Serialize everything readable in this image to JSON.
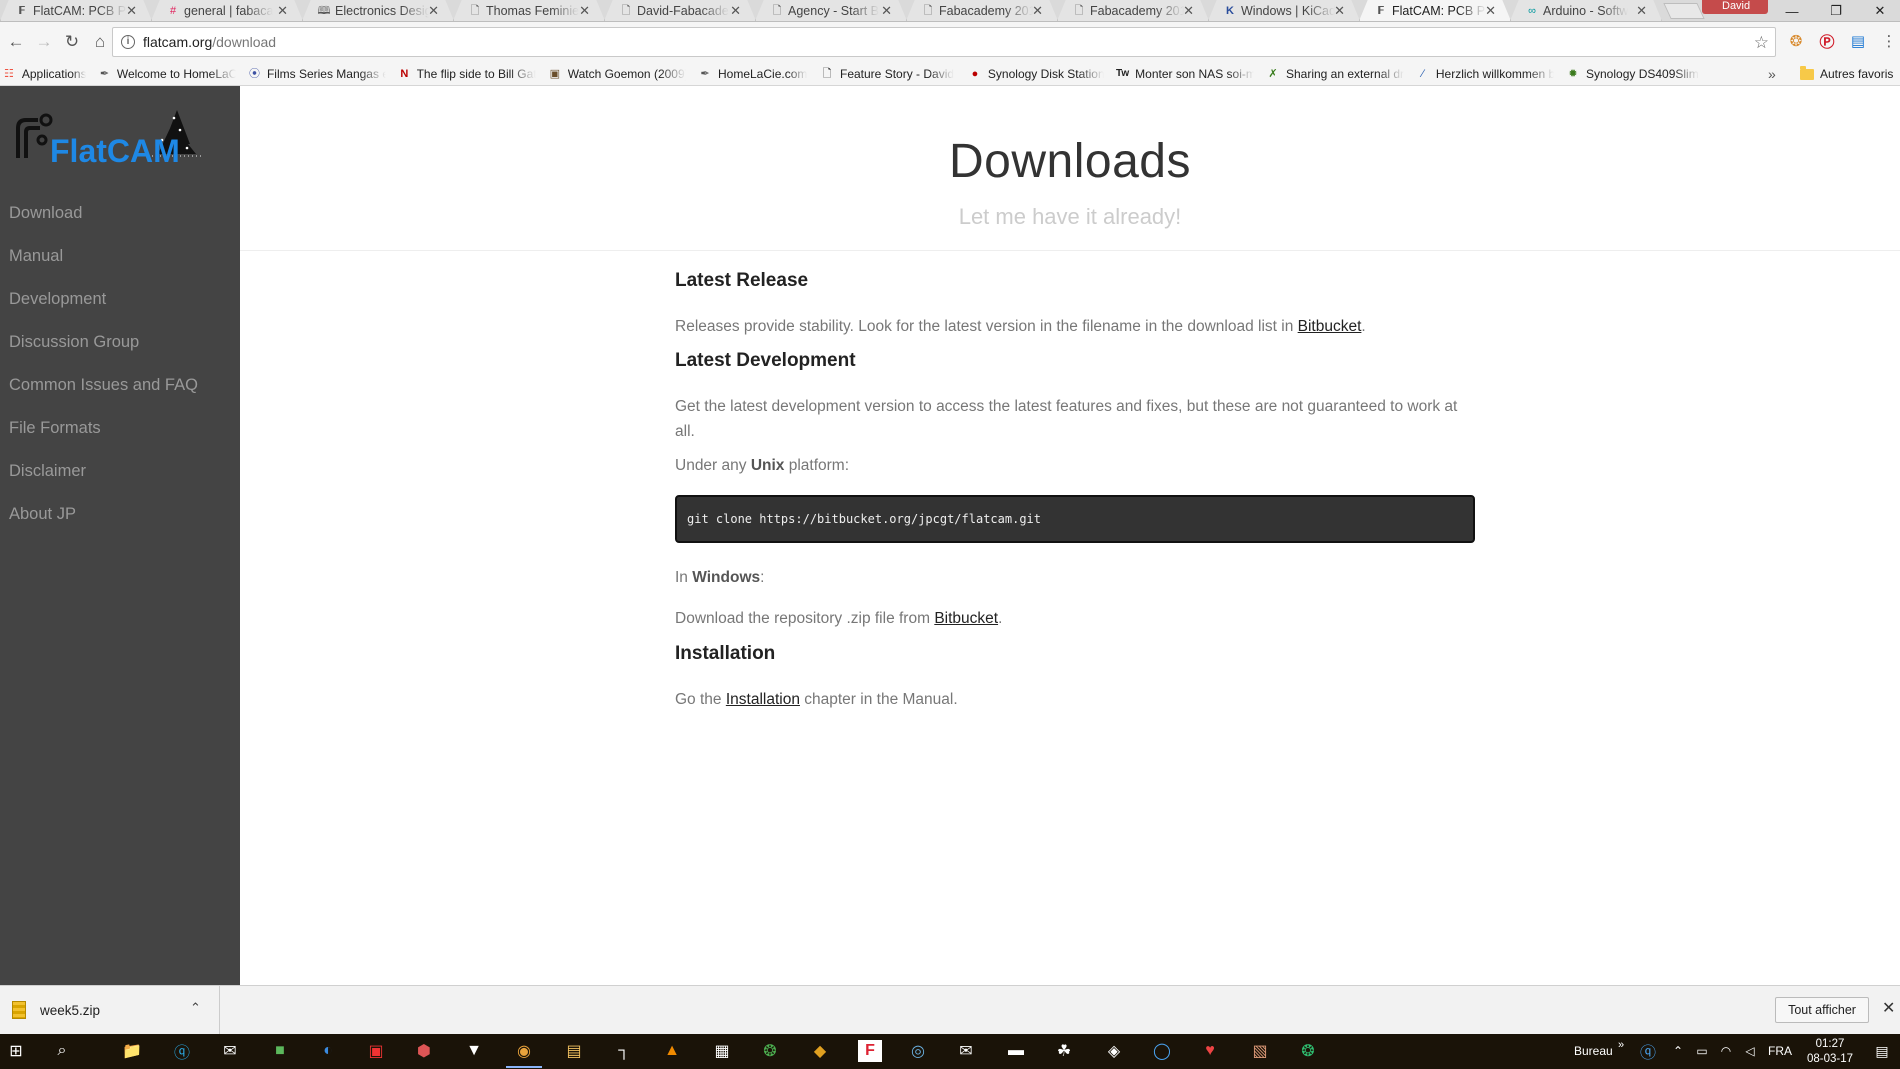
{
  "browser": {
    "tabs": [
      {
        "label": "FlatCAM: PCB Pr",
        "icon": "flatcam-icon",
        "active": false
      },
      {
        "label": "general | fabaca",
        "icon": "slack-icon",
        "active": false
      },
      {
        "label": "Electronics Desig",
        "icon": "book-icon",
        "active": false
      },
      {
        "label": "Thomas Feminie",
        "icon": "page-icon",
        "active": false
      },
      {
        "label": "David-Fabacade",
        "icon": "page-icon",
        "active": false
      },
      {
        "label": "Agency - Start B",
        "icon": "page-icon",
        "active": false
      },
      {
        "label": "Fabacademy 201",
        "icon": "page-icon",
        "active": false
      },
      {
        "label": "Fabacademy 201",
        "icon": "page-icon",
        "active": false
      },
      {
        "label": "Windows | KiCad",
        "icon": "kicad-icon",
        "active": false
      },
      {
        "label": "FlatCAM: PCB Pr",
        "icon": "flatcam-icon",
        "active": true
      },
      {
        "label": "Arduino - Softw",
        "icon": "arduino-icon",
        "active": false
      }
    ],
    "profile_name": "David",
    "url_host": "flatcam.org",
    "url_path": "/download",
    "bookmarks": [
      {
        "label": "Applications",
        "icon": "apps-grid-icon"
      },
      {
        "label": "Welcome to HomeLaCie",
        "icon": "feather-icon"
      },
      {
        "label": "Films Series Mangas en",
        "icon": "link-icon"
      },
      {
        "label": "The flip side to Bill Gates",
        "icon": "netflix-icon"
      },
      {
        "label": "Watch Goemon (2009)",
        "icon": "film-icon"
      },
      {
        "label": "HomeLaCie.com",
        "icon": "feather-icon"
      },
      {
        "label": "Feature Story - David",
        "icon": "page-icon"
      },
      {
        "label": "Synology Disk Station",
        "icon": "synology-icon"
      },
      {
        "label": "Monter son NAS soi-même",
        "icon": "tw-icon"
      },
      {
        "label": "Sharing an external dr",
        "icon": "x-icon"
      },
      {
        "label": "Herzlich willkommen b",
        "icon": "slash-icon"
      },
      {
        "label": "Synology DS409Slim",
        "icon": "star-badge-icon"
      }
    ],
    "other_bookmarks": "Autres favoris"
  },
  "sidebar": {
    "logo_text": "FlatCAM",
    "items": [
      {
        "label": "Download"
      },
      {
        "label": "Manual"
      },
      {
        "label": "Development"
      },
      {
        "label": "Discussion Group"
      },
      {
        "label": "Common Issues and FAQ"
      },
      {
        "label": "File Formats"
      },
      {
        "label": "Disclaimer"
      },
      {
        "label": "About JP"
      }
    ]
  },
  "page": {
    "title": "Downloads",
    "subtitle": "Let me have it already!",
    "latest_release": {
      "heading": "Latest Release",
      "text": "Releases provide stability. Look for the latest version in the filename in the download list in ",
      "link": "Bitbucket",
      "end": "."
    },
    "latest_development": {
      "heading": "Latest Development",
      "text": "Get the latest development version to access the latest features and fixes, but these are not guaranteed to work at all.",
      "unix_pre": "Under any ",
      "unix_bold": "Unix",
      "unix_post": " platform:",
      "code": "git clone https://bitbucket.org/jpcgt/flatcam.git",
      "windows_pre": "In ",
      "windows_bold": "Windows",
      "windows_post": ":",
      "download_pre": "Download the repository .zip file from ",
      "download_link": "Bitbucket",
      "download_end": "."
    },
    "installation": {
      "heading": "Installation",
      "pre": "Go the ",
      "link": "Installation",
      "post": " chapter in the Manual."
    }
  },
  "download_shelf": {
    "file_name": "week5.zip",
    "show_all": "Tout afficher"
  },
  "taskbar": {
    "desktop_label": "Bureau",
    "language": "FRA",
    "time": "01:27",
    "date": "08-03-17"
  },
  "colors": {
    "sidebar_bg": "#444444",
    "sidebar_text": "#999999",
    "code_bg": "#333333",
    "logo_blue": "#1e88e5"
  }
}
